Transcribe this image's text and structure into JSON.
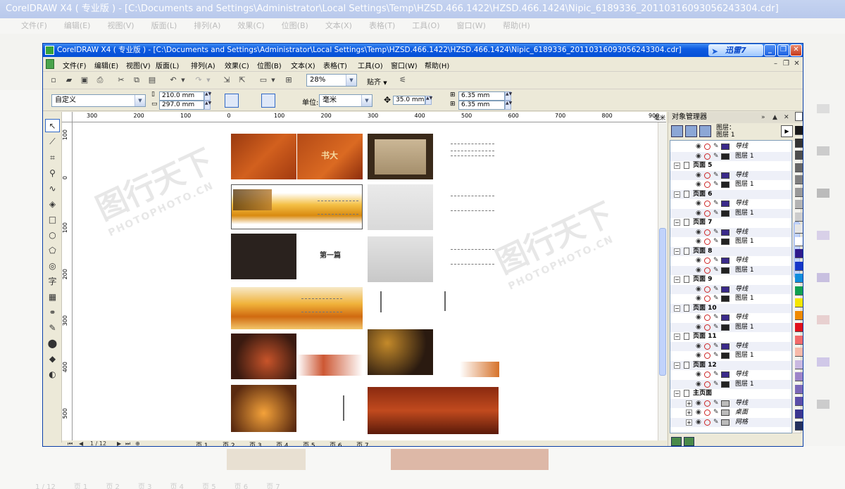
{
  "window": {
    "title": "CorelDRAW X4 ( 专业版 ) - [C:\\Documents and Settings\\Administrator\\Local Settings\\Temp\\HZSD.466.1422\\HZSD.466.1424\\Nipic_6189336_20110316093056243304.cdr]",
    "xunlei_label": "迅雷7"
  },
  "background": {
    "title": "CorelDRAW X4 ( 专业版 ) - [C:\\Documents and Settings\\Administrator\\Local Settings\\Temp\\HZSD.466.1422\\HZSD.466.1424\\Nipic_6189336_20110316093056243304.cdr]",
    "menu": [
      "文件(F)",
      "编辑(E)",
      "视图(V)",
      "版面(L)",
      "排列(A)",
      "效果(C)",
      "位图(B)",
      "文本(X)",
      "表格(T)",
      "工具(O)",
      "窗口(W)",
      "帮助(H)"
    ],
    "tabs": [
      "页 1",
      "页 2",
      "页 3",
      "页 4",
      "页 5",
      "页 6",
      "页 7"
    ],
    "page_counter": "1 / 12"
  },
  "menu": [
    "文件(F)",
    "编辑(E)",
    "视图(V)",
    "版面(L)",
    "排列(A)",
    "效果(C)",
    "位图(B)",
    "文本(X)",
    "表格(T)",
    "工具(O)",
    "窗口(W)",
    "帮助(H)"
  ],
  "toolbar": {
    "zoom": "28%",
    "snap_label": "贴齐"
  },
  "property_bar": {
    "page_size": "自定义",
    "width": "210.0 mm",
    "height": "297.0 mm",
    "unit_label": "单位:",
    "unit": "毫米",
    "nudge": "35.0 mm",
    "dup_x": "6.35 mm",
    "dup_y": "6.35 mm"
  },
  "ruler": {
    "top": [
      "300",
      "200",
      "100",
      "0",
      "100",
      "200",
      "300",
      "400",
      "500",
      "600",
      "700",
      "800",
      "900"
    ],
    "unit": "毫米",
    "left": [
      "100",
      "0",
      "100",
      "200",
      "300",
      "400",
      "500"
    ]
  },
  "canvas": {
    "thumbnail_texts": [
      "书大",
      "第一篇"
    ]
  },
  "watermark": {
    "brand": "图行天下",
    "site": "PHOTOPHOTO.CN"
  },
  "status": {
    "page_counter": "1 / 12",
    "tabs": [
      "页 1",
      "页 2",
      "页 3",
      "页 4",
      "页 5",
      "页 6",
      "页 7"
    ]
  },
  "object_manager": {
    "title": "对象管理器",
    "layer_label": "图层：",
    "layer_value": "图层 1",
    "rows": [
      {
        "type": "layer",
        "label": "导线",
        "color": "#3a2a8a"
      },
      {
        "type": "layer",
        "label": "图层 1",
        "color": "#222222"
      },
      {
        "type": "page",
        "label": "页面 5"
      },
      {
        "type": "layer",
        "label": "导线",
        "color": "#3a2a8a"
      },
      {
        "type": "layer",
        "label": "图层 1",
        "color": "#222222"
      },
      {
        "type": "page",
        "label": "页面 6"
      },
      {
        "type": "layer",
        "label": "导线",
        "color": "#3a2a8a"
      },
      {
        "type": "layer",
        "label": "图层 1",
        "color": "#222222"
      },
      {
        "type": "page",
        "label": "页面 7"
      },
      {
        "type": "layer",
        "label": "导线",
        "color": "#3a2a8a"
      },
      {
        "type": "layer",
        "label": "图层 1",
        "color": "#222222"
      },
      {
        "type": "page",
        "label": "页面 8"
      },
      {
        "type": "layer",
        "label": "导线",
        "color": "#3a2a8a"
      },
      {
        "type": "layer",
        "label": "图层 1",
        "color": "#222222"
      },
      {
        "type": "page",
        "label": "页面 9"
      },
      {
        "type": "layer",
        "label": "导线",
        "color": "#3a2a8a"
      },
      {
        "type": "layer",
        "label": "图层 1",
        "color": "#222222"
      },
      {
        "type": "page",
        "label": "页面 10"
      },
      {
        "type": "layer",
        "label": "导线",
        "color": "#3a2a8a"
      },
      {
        "type": "layer",
        "label": "图层 1",
        "color": "#222222"
      },
      {
        "type": "page",
        "label": "页面 11"
      },
      {
        "type": "layer",
        "label": "导线",
        "color": "#3a2a8a"
      },
      {
        "type": "layer",
        "label": "图层 1",
        "color": "#222222"
      },
      {
        "type": "page",
        "label": "页面 12"
      },
      {
        "type": "layer",
        "label": "导线",
        "color": "#3a2a8a"
      },
      {
        "type": "layer",
        "label": "图层 1",
        "color": "#222222"
      },
      {
        "type": "page",
        "label": "主页面"
      },
      {
        "type": "master",
        "label": "导线",
        "color": "#bbbbbb"
      },
      {
        "type": "master",
        "label": "桌面",
        "color": "#bbbbbb"
      },
      {
        "type": "master",
        "label": "网格",
        "color": "#bbbbbb"
      }
    ]
  },
  "palette": [
    "#1a1a1a",
    "#333333",
    "#4d4d4d",
    "#666666",
    "#808080",
    "#999999",
    "#b3b3b3",
    "#cccccc",
    "#e6e6e6",
    "#ffffff",
    "#2e1a8c",
    "#1536c8",
    "#118ddc",
    "#10a050",
    "#f5e600",
    "#f08a00",
    "#e0101a",
    "#f26a6a",
    "#f7b9a8",
    "#c9b8e0",
    "#9d84c8",
    "#7b68b8",
    "#5b4ea8",
    "#3b3690",
    "#24305e"
  ]
}
